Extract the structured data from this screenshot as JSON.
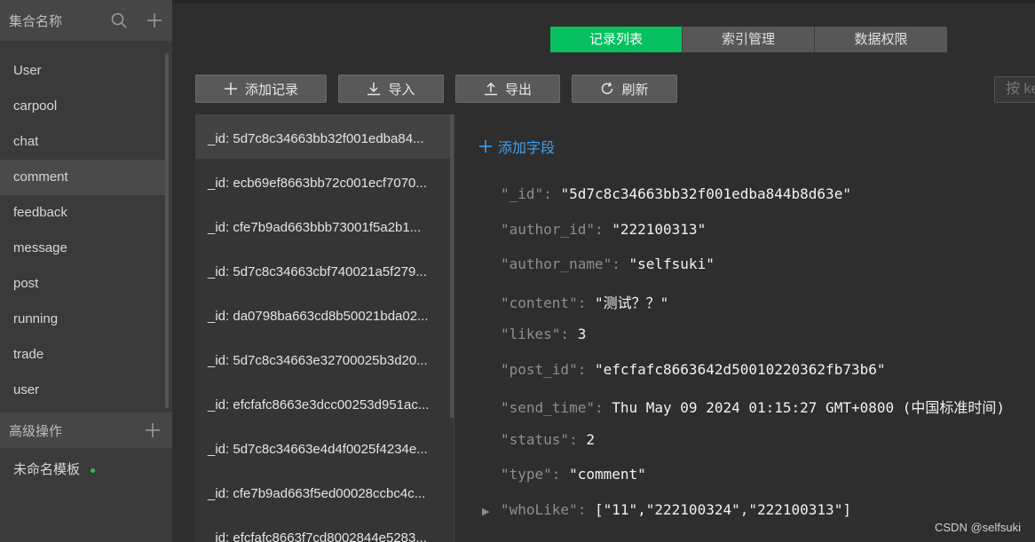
{
  "sidebar": {
    "collections_title": "集合名称",
    "collections": [
      "User",
      "carpool",
      "chat",
      "comment",
      "feedback",
      "message",
      "post",
      "running",
      "trade",
      "user"
    ],
    "active_collection": "comment",
    "advanced_title": "高级操作",
    "template_label": "未命名模板"
  },
  "tabs": [
    "记录列表",
    "索引管理",
    "数据权限"
  ],
  "toolbar": {
    "add_label": "添加记录",
    "import_label": "导入",
    "export_label": "导出",
    "refresh_label": "刷新"
  },
  "search": {
    "placeholder": "按 ke"
  },
  "records": [
    "_id: 5d7c8c34663bb32f001edba84...",
    "_id: ecb69ef8663bb72c001ecf7070...",
    "_id: cfe7b9ad663bbb73001f5a2b1...",
    "_id: 5d7c8c34663cbf740021a5f279...",
    "_id: da0798ba663cd8b50021bda02...",
    "_id: 5d7c8c34663e32700025b3d20...",
    "_id: efcfafc8663e3dcc00253d951ac...",
    "_id: 5d7c8c34663e4d4f0025f4234e...",
    "_id: cfe7b9ad663f5ed00028ccbc4c...",
    "_id: efcfafc8663f7cd8002844e5283..."
  ],
  "detail": {
    "add_field_label": "添加字段",
    "fields": [
      {
        "key": "\"_id\"",
        "value": "\"5d7c8c34663bb32f001edba844b8d63e\""
      },
      {
        "key": "\"author_id\"",
        "value": "\"222100313\""
      },
      {
        "key": "\"author_name\"",
        "value": "\"selfsuki\""
      },
      {
        "key": "\"content\"",
        "value": "\"测试？？\""
      },
      {
        "key": "\"likes\"",
        "value": "3"
      },
      {
        "key": "\"post_id\"",
        "value": "\"efcfafc8663642d50010220362fb73b6\""
      },
      {
        "key": "\"send_time\"",
        "value": "Thu May 09 2024 01:15:27 GMT+0800 (中国标准时间)"
      },
      {
        "key": "\"status\"",
        "value": "2"
      },
      {
        "key": "\"type\"",
        "value": "\"comment\""
      },
      {
        "key": "\"whoLike\"",
        "value": "[\"11\",\"222100324\",\"222100313\"]"
      }
    ]
  },
  "watermark": "CSDN @selfsuki",
  "colors": {
    "accent_green": "#07c160",
    "link_blue": "#3fa0ef",
    "bg": "#2e2e2e"
  }
}
